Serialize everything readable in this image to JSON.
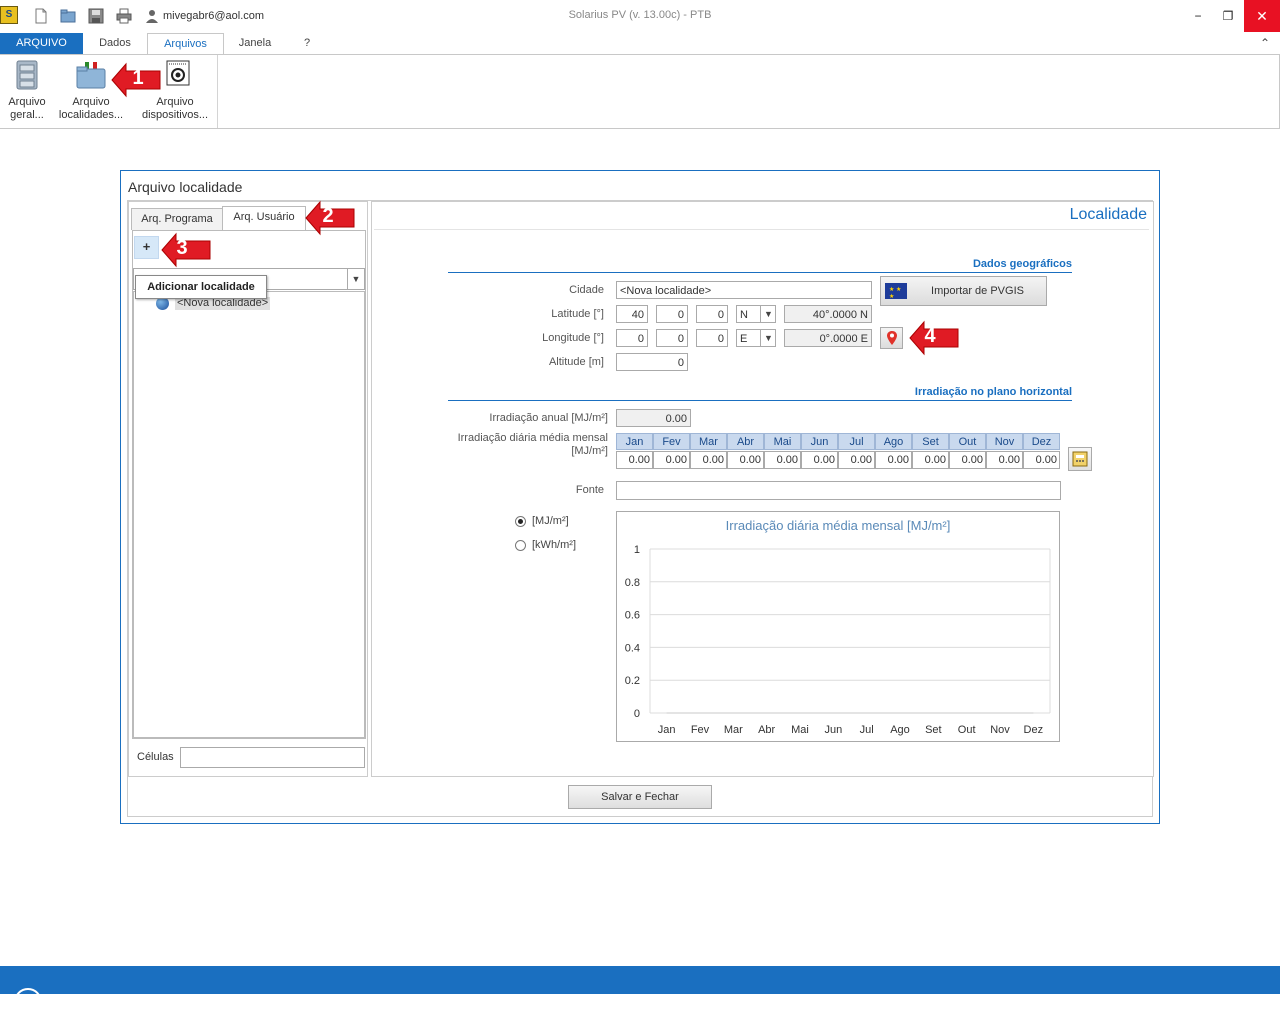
{
  "app": {
    "title": "Solarius PV (v. 13.00c) - PTB",
    "user": "mivegabr6@aol.com"
  },
  "window_controls": {
    "minimize": "−",
    "restore": "❐",
    "close": "✕"
  },
  "ribbon": {
    "tabs": [
      "ARQUIVO",
      "Dados",
      "Arquivos",
      "Janela",
      "?"
    ],
    "active_tab": "Arquivos",
    "collapse": "⌃",
    "buttons": [
      {
        "line1": "Arquivo",
        "line2": "geral..."
      },
      {
        "line1": "Arquivo",
        "line2": "localidades..."
      },
      {
        "line1": "Arquivo",
        "line2": "dispositivos..."
      }
    ]
  },
  "dialog": {
    "title": "Arquivo localidade",
    "left_tabs": [
      "Arq. Programa",
      "Arq. Usuário"
    ],
    "add_button": "+",
    "tooltip": "Adicionar localidade",
    "combo_arrow": "▼",
    "tree_item": "<Nova localidade>",
    "celulas_label": "Células",
    "save_button": "Salvar e Fechar"
  },
  "localidade": {
    "title": "Localidade",
    "geo_section": "Dados geográficos",
    "cidade_label": "Cidade",
    "cidade_value": "<Nova localidade>",
    "pvgis_button": "Importar de PVGIS",
    "latitude_label": "Latitude [°]",
    "latitude": {
      "deg": "40",
      "min": "0",
      "sec": "0",
      "hemi": "N",
      "decimal": "40°.0000 N"
    },
    "longitude_label": "Longitude [°]",
    "longitude": {
      "deg": "0",
      "min": "0",
      "sec": "0",
      "hemi": "E",
      "decimal": "0°.0000 E"
    },
    "altitude_label": "Altitude [m]",
    "altitude_value": "0",
    "irr_section": "Irradiação no plano horizontal",
    "irr_anual_label": "Irradiação anual [MJ/m²]",
    "irr_anual_value": "0.00",
    "irr_diaria_label_1": "Irradiação diária média mensal",
    "irr_diaria_label_2": "[MJ/m²]",
    "months": [
      "Jan",
      "Fev",
      "Mar",
      "Abr",
      "Mai",
      "Jun",
      "Jul",
      "Ago",
      "Set",
      "Out",
      "Nov",
      "Dez"
    ],
    "monthly_values": [
      "0.00",
      "0.00",
      "0.00",
      "0.00",
      "0.00",
      "0.00",
      "0.00",
      "0.00",
      "0.00",
      "0.00",
      "0.00",
      "0.00"
    ],
    "fonte_label": "Fonte",
    "fonte_value": "",
    "unit_mj": "[MJ/m²]",
    "unit_kwh": "[kWh/m²]",
    "selected_unit": "[MJ/m²]"
  },
  "callouts": [
    "1",
    "2",
    "3",
    "4"
  ],
  "colors": {
    "accent": "#1a6fc0",
    "callout": "#e01b24",
    "close": "#e81123"
  },
  "chart_data": {
    "type": "line",
    "title": "Irradiação diária média mensal [MJ/m²]",
    "categories": [
      "Jan",
      "Fev",
      "Mar",
      "Abr",
      "Mai",
      "Jun",
      "Jul",
      "Ago",
      "Set",
      "Out",
      "Nov",
      "Dez"
    ],
    "values": [
      0,
      0,
      0,
      0,
      0,
      0,
      0,
      0,
      0,
      0,
      0,
      0
    ],
    "yticks": [
      "0",
      "0.2",
      "0.4",
      "0.6",
      "0.8",
      "1"
    ],
    "ylim": [
      0,
      1
    ],
    "grid": true,
    "xlabel": "",
    "ylabel": ""
  }
}
